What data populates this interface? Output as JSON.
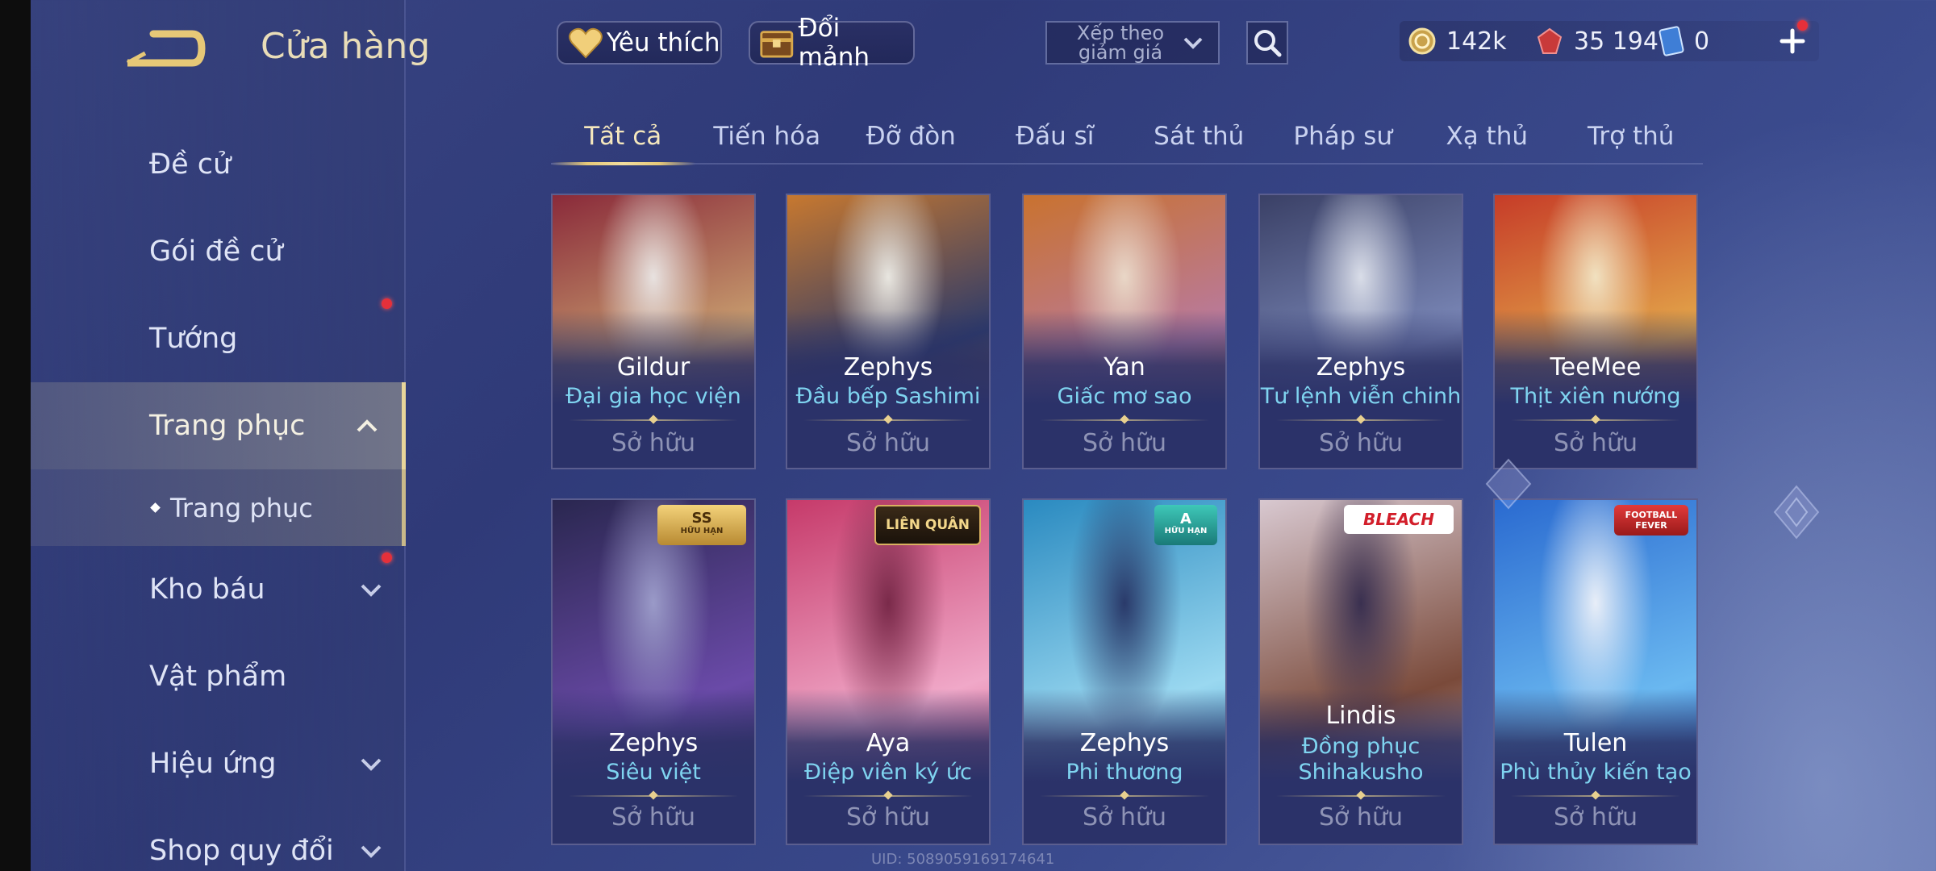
{
  "header": {
    "title": "Cửa hàng",
    "favorites_label": "Yêu thích",
    "exchange_label": "Đổi mảnh",
    "sort_label": "Xếp theo giảm giá"
  },
  "currencies": {
    "gold": "142k",
    "vouchers": "35 194",
    "tickets": "0"
  },
  "sidebar": {
    "items": [
      {
        "label": "Đề cử"
      },
      {
        "label": "Gói đề cử"
      },
      {
        "label": "Tướng"
      },
      {
        "label": "Trang phục"
      },
      {
        "label": "Trang phục"
      },
      {
        "label": "Kho báu"
      },
      {
        "label": "Vật phẩm"
      },
      {
        "label": "Hiệu ứng"
      },
      {
        "label": "Shop quy đổi"
      }
    ]
  },
  "tabs": [
    "Tất cả",
    "Tiến hóa",
    "Đỡ đòn",
    "Đấu sĩ",
    "Sát thủ",
    "Pháp sư",
    "Xạ thủ",
    "Trợ thủ"
  ],
  "cards": [
    {
      "hero": "Gildur",
      "skin": "Đại gia học viện",
      "status": "Sở hữu",
      "colors": [
        "#8a2a3a",
        "#c9a070",
        "#e8e2e0"
      ]
    },
    {
      "hero": "Zephys",
      "skin": "Đầu bếp Sashimi",
      "status": "Sở hữu",
      "colors": [
        "#c7782f",
        "#2c3a6a",
        "#e8e6e0"
      ]
    },
    {
      "hero": "Yan",
      "skin": "Giấc mơ sao",
      "status": "Sở hữu",
      "colors": [
        "#c9722f",
        "#b87aa0",
        "#e9d7c7"
      ]
    },
    {
      "hero": "Zephys",
      "skin": "Tư lệnh viễn chinh",
      "status": "Sở hữu",
      "colors": [
        "#3a4066",
        "#7b88b8",
        "#d9dde8"
      ]
    },
    {
      "hero": "TeeMee",
      "skin": "Thịt xiên nướng",
      "status": "Sở hữu",
      "colors": [
        "#c63c28",
        "#e3a64a",
        "#f1e1c0"
      ]
    },
    {
      "hero": "Zephys",
      "skin": "Siêu việt",
      "status": "Sở hữu",
      "badge": "SS",
      "badge_sub": "HỮU HẠN",
      "colors": [
        "#2a2750",
        "#6a4aa8",
        "#9a9ac8"
      ]
    },
    {
      "hero": "Aya",
      "skin": "Điệp viên ký ức",
      "status": "Sở hữu",
      "badge": "LIÊN QUÂN",
      "colors": [
        "#c63a6a",
        "#f0a8c8",
        "#7a2a4a"
      ]
    },
    {
      "hero": "Zephys",
      "skin": "Phi thương",
      "status": "Sở hữu",
      "badge": "A",
      "badge_sub": "HỮU HẠN",
      "colors": [
        "#2a8ac0",
        "#9ad8f0",
        "#2a3a6a"
      ]
    },
    {
      "hero": "Lindis",
      "skin": "Đồng phục Shihakusho",
      "skin_line1": "Đồng phục",
      "skin_line2": "Shihakusho",
      "status": "Sở hữu",
      "badge": "BLEACH",
      "colors": [
        "#d8c8d0",
        "#7a4a3a",
        "#3a3050"
      ]
    },
    {
      "hero": "Tulen",
      "skin": "Phù thủy kiến tạo",
      "status": "Sở hữu",
      "badge": "FOOTBALL FEVER",
      "colors": [
        "#2a6ad0",
        "#6ab8f0",
        "#e8eef8"
      ]
    }
  ],
  "uid": "UID: 5089059169174641",
  "colors": {
    "accent_gold": "#e8d59a",
    "skin_name": "#7fd4f0",
    "owned_text": "#8e93b5",
    "notification": "#e5303a"
  }
}
